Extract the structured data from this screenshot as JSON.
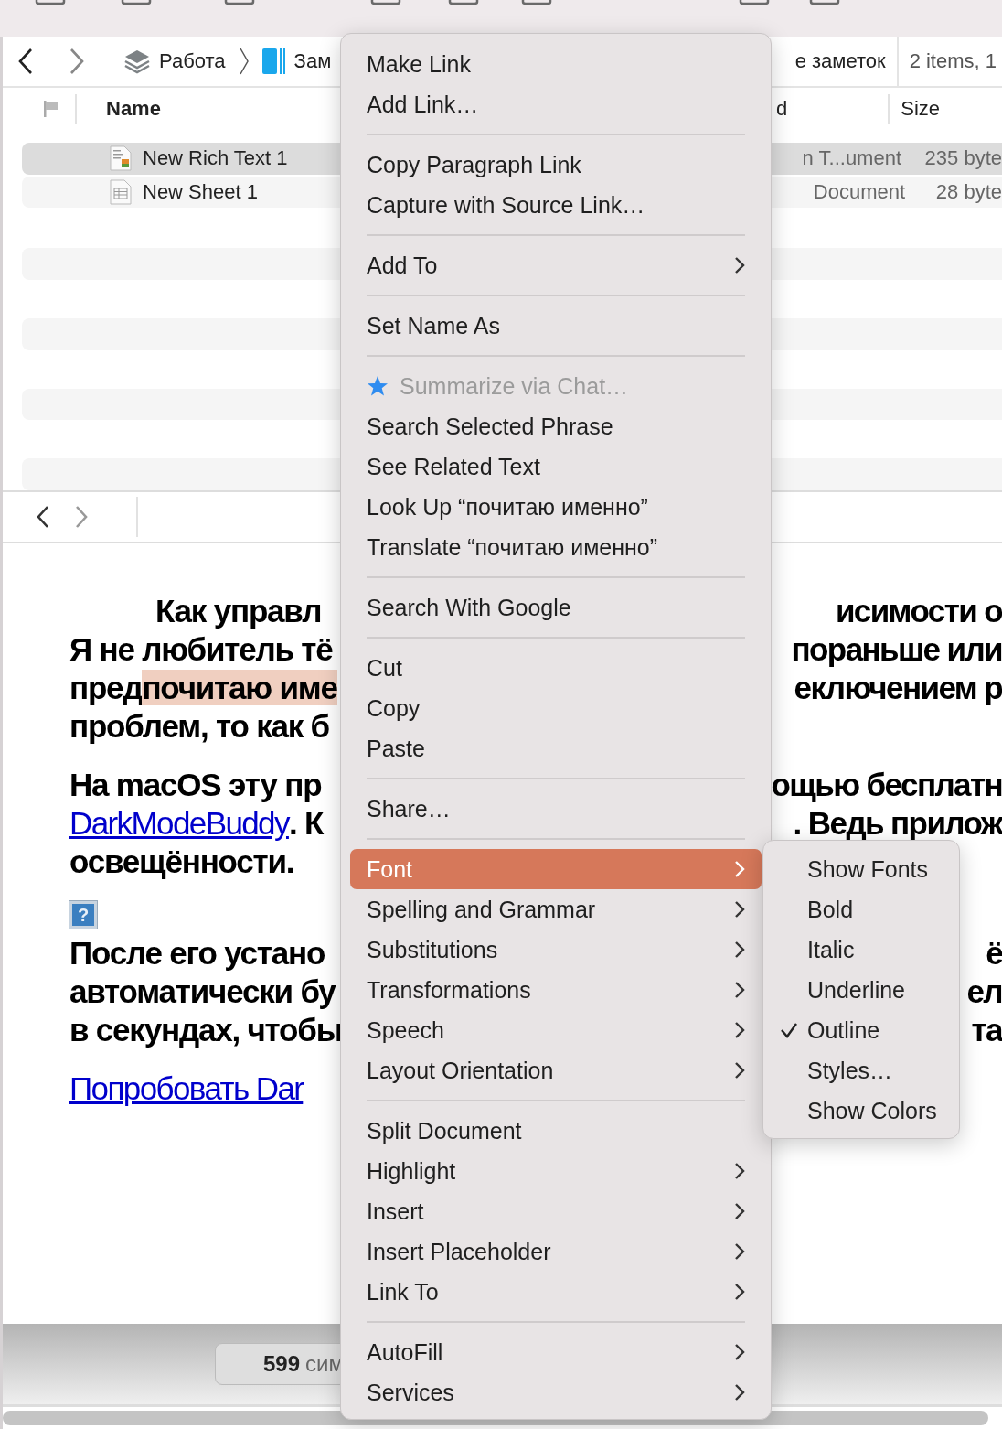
{
  "path_bar": {
    "crumbs": [
      {
        "label": "Работа",
        "kind": "stack"
      },
      {
        "label": "Зам",
        "kind": "notebook"
      }
    ],
    "right_crumb": "е заметок",
    "summary": "2 items, 1"
  },
  "columns": {
    "name": "Name",
    "kind": "d",
    "size": "Size"
  },
  "files": [
    {
      "name": "New Rich Text 1",
      "kind_text": "n T...ument",
      "size": "235 byte",
      "kind": "rich",
      "selected": true
    },
    {
      "name": "New Sheet 1",
      "kind_text": "Document",
      "size": "28 byte",
      "kind": "sheet",
      "selected": false
    }
  ],
  "document": [
    {
      "kind": "heading",
      "lines": [
        {
          "left": [
            {
              "text": "Как управл",
              "kind": "plain"
            }
          ],
          "right": "исимости о"
        }
      ]
    },
    {
      "kind": "text",
      "lines": [
        {
          "left": [
            {
              "text": "Я не любитель тё",
              "kind": "plain"
            }
          ],
          "right": "пораньше или"
        },
        {
          "left": [
            {
              "text": "пред",
              "kind": "plain"
            },
            {
              "text": "почитаю име",
              "kind": "highlight"
            }
          ],
          "right": "еключением р"
        },
        {
          "left": [
            {
              "text": "проблем, то как б",
              "kind": "plain"
            }
          ]
        }
      ]
    },
    {
      "kind": "text",
      "lines": [
        {
          "left": [
            {
              "text": "На macOS эту пр",
              "kind": "plain"
            }
          ],
          "right": "ощью бесплатн"
        },
        {
          "left": [
            {
              "text": "DarkModeBuddy",
              "kind": "link"
            },
            {
              "text": ". К",
              "kind": "plain"
            }
          ],
          "right": ". Ведь прилож"
        },
        {
          "left": [
            {
              "text": "освещённости.",
              "kind": "plain"
            }
          ]
        }
      ]
    },
    {
      "kind": "image",
      "glyph": "?"
    },
    {
      "kind": "text",
      "lines": [
        {
          "left": [
            {
              "text": "После его устано",
              "kind": "plain"
            }
          ],
          "right": "ё"
        },
        {
          "left": [
            {
              "text": "автоматически бу",
              "kind": "plain"
            }
          ],
          "right": "ел"
        },
        {
          "left": [
            {
              "text": "в секундах, чтобы",
              "kind": "plain"
            }
          ],
          "right": "та"
        }
      ]
    },
    {
      "kind": "text",
      "lines": [
        {
          "left": [
            {
              "text": "Попробовать Dar",
              "kind": "link"
            }
          ]
        }
      ]
    }
  ],
  "status_bar": {
    "count": "599",
    "unit": "сим"
  },
  "context_menu": [
    {
      "items": [
        {
          "label": "Make Link",
          "kind": "plain",
          "submenu": false,
          "disabled": false,
          "selected": false
        },
        {
          "label": "Add Link…",
          "kind": "plain",
          "submenu": false,
          "disabled": false,
          "selected": false
        }
      ]
    },
    {
      "items": [
        {
          "label": "Copy Paragraph Link",
          "kind": "plain",
          "submenu": false,
          "disabled": false,
          "selected": false
        },
        {
          "label": "Capture with Source Link…",
          "kind": "plain",
          "submenu": false,
          "disabled": false,
          "selected": false
        }
      ]
    },
    {
      "items": [
        {
          "label": "Add To",
          "kind": "plain",
          "submenu": true,
          "disabled": false,
          "selected": false
        }
      ]
    },
    {
      "items": [
        {
          "label": "Set Name As",
          "kind": "plain",
          "submenu": false,
          "disabled": false,
          "selected": false
        }
      ]
    },
    {
      "items": [
        {
          "label": "Summarize via Chat…",
          "kind": "starred",
          "submenu": false,
          "disabled": true,
          "selected": false
        },
        {
          "label": "Search Selected Phrase",
          "kind": "plain",
          "submenu": false,
          "disabled": false,
          "selected": false
        },
        {
          "label": "See Related Text",
          "kind": "plain",
          "submenu": false,
          "disabled": false,
          "selected": false
        },
        {
          "label": "Look Up “почитаю именно”",
          "kind": "plain",
          "submenu": false,
          "disabled": false,
          "selected": false
        },
        {
          "label": "Translate “почитаю именно”",
          "kind": "plain",
          "submenu": false,
          "disabled": false,
          "selected": false
        }
      ]
    },
    {
      "items": [
        {
          "label": "Search With Google",
          "kind": "plain",
          "submenu": false,
          "disabled": false,
          "selected": false
        }
      ]
    },
    {
      "items": [
        {
          "label": "Cut",
          "kind": "plain",
          "submenu": false,
          "disabled": false,
          "selected": false
        },
        {
          "label": "Copy",
          "kind": "plain",
          "submenu": false,
          "disabled": false,
          "selected": false
        },
        {
          "label": "Paste",
          "kind": "plain",
          "submenu": false,
          "disabled": false,
          "selected": false
        }
      ]
    },
    {
      "items": [
        {
          "label": "Share…",
          "kind": "plain",
          "submenu": false,
          "disabled": false,
          "selected": false
        }
      ]
    },
    {
      "items": [
        {
          "label": "Font",
          "kind": "plain",
          "submenu": true,
          "disabled": false,
          "selected": true
        },
        {
          "label": "Spelling and Grammar",
          "kind": "plain",
          "submenu": true,
          "disabled": false,
          "selected": false
        },
        {
          "label": "Substitutions",
          "kind": "plain",
          "submenu": true,
          "disabled": false,
          "selected": false
        },
        {
          "label": "Transformations",
          "kind": "plain",
          "submenu": true,
          "disabled": false,
          "selected": false
        },
        {
          "label": "Speech",
          "kind": "plain",
          "submenu": true,
          "disabled": false,
          "selected": false
        },
        {
          "label": "Layout Orientation",
          "kind": "plain",
          "submenu": true,
          "disabled": false,
          "selected": false
        }
      ]
    },
    {
      "items": [
        {
          "label": "Split Document",
          "kind": "plain",
          "submenu": false,
          "disabled": false,
          "selected": false
        },
        {
          "label": "Highlight",
          "kind": "plain",
          "submenu": true,
          "disabled": false,
          "selected": false
        },
        {
          "label": "Insert",
          "kind": "plain",
          "submenu": true,
          "disabled": false,
          "selected": false
        },
        {
          "label": "Insert Placeholder",
          "kind": "plain",
          "submenu": true,
          "disabled": false,
          "selected": false
        },
        {
          "label": "Link To",
          "kind": "plain",
          "submenu": true,
          "disabled": false,
          "selected": false
        }
      ]
    },
    {
      "items": [
        {
          "label": "AutoFill",
          "kind": "plain",
          "submenu": true,
          "disabled": false,
          "selected": false
        },
        {
          "label": "Services",
          "kind": "plain",
          "submenu": true,
          "disabled": false,
          "selected": false
        }
      ]
    }
  ],
  "font_submenu": [
    {
      "label": "Show Fonts",
      "checked": false
    },
    {
      "label": "Bold",
      "checked": false
    },
    {
      "label": "Italic",
      "checked": false
    },
    {
      "label": "Underline",
      "checked": false
    },
    {
      "label": "Outline",
      "checked": true
    },
    {
      "label": "Styles…",
      "checked": false
    },
    {
      "label": "Show Colors",
      "checked": false
    }
  ]
}
